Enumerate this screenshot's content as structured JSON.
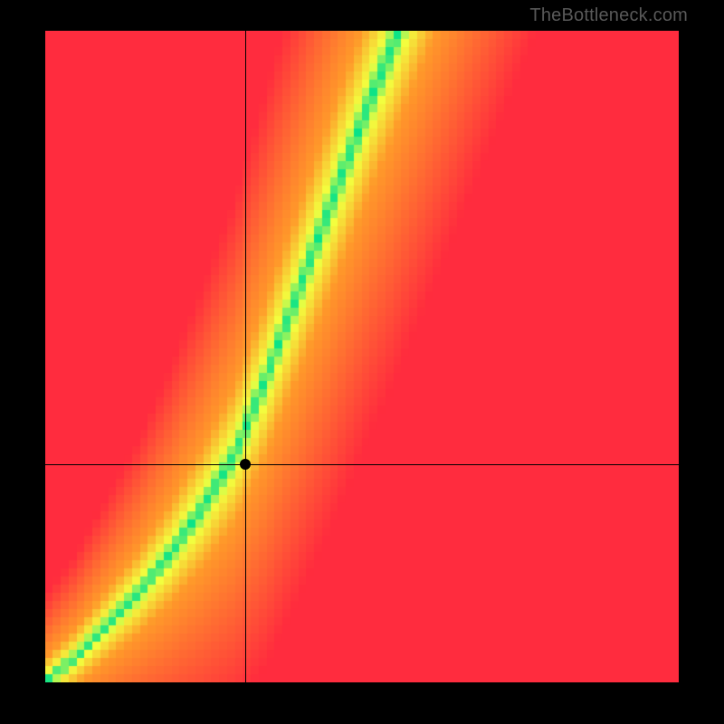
{
  "watermark": "TheBottleneck.com",
  "chart_data": {
    "type": "heatmap",
    "title": "",
    "xlabel": "",
    "ylabel": "",
    "xlim": [
      0,
      1
    ],
    "ylim": [
      0,
      1
    ],
    "crosshair": {
      "x": 0.315,
      "y": 0.335
    },
    "marker": {
      "x": 0.315,
      "y": 0.335
    },
    "ridge": {
      "comment": "approximate centerline of the green optimal band as (x, y) fractions of plot area, origin at bottom-left",
      "points": [
        [
          0.0,
          0.0
        ],
        [
          0.05,
          0.04
        ],
        [
          0.1,
          0.09
        ],
        [
          0.15,
          0.14
        ],
        [
          0.2,
          0.2
        ],
        [
          0.25,
          0.27
        ],
        [
          0.3,
          0.35
        ],
        [
          0.35,
          0.47
        ],
        [
          0.4,
          0.6
        ],
        [
          0.45,
          0.73
        ],
        [
          0.5,
          0.86
        ],
        [
          0.55,
          0.98
        ]
      ],
      "half_width": [
        0.01,
        0.012,
        0.015,
        0.018,
        0.022,
        0.026,
        0.03,
        0.034,
        0.036,
        0.038,
        0.039,
        0.04
      ]
    },
    "colors": {
      "optimal": "#00e28c",
      "good": "#f3ff3f",
      "mid": "#ff9a2a",
      "bad": "#ff2c3e"
    },
    "grid_resolution": 80
  }
}
